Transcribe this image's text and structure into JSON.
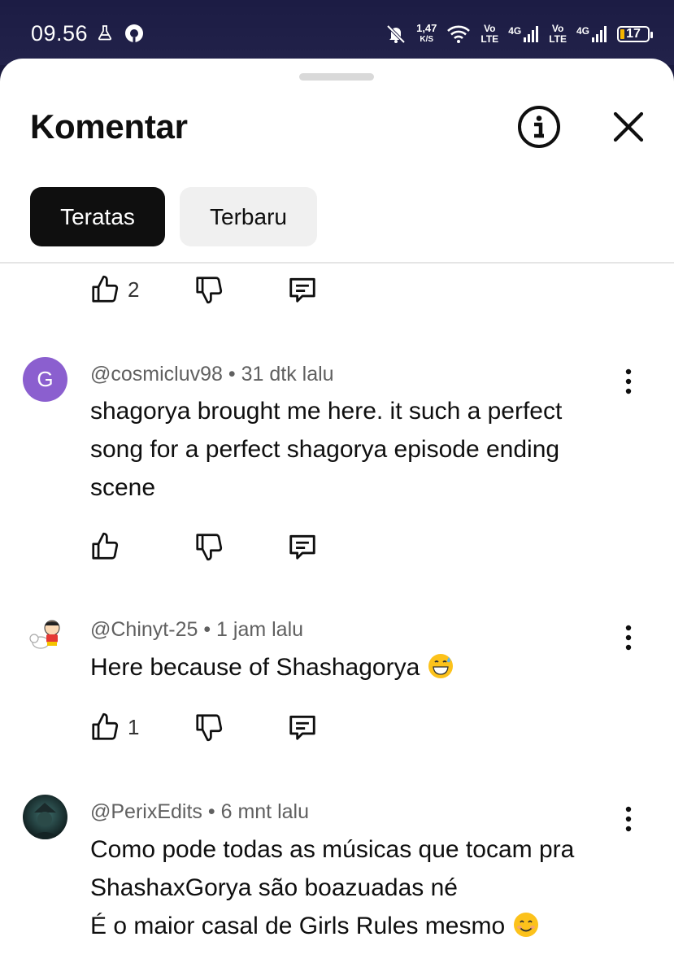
{
  "status": {
    "time": "09.56",
    "net_speed": "1,47",
    "net_unit": "K/S",
    "volte1_top": "Vo",
    "volte1_bottom": "LTE",
    "sim1_type": "4G",
    "volte2_top": "Vo",
    "volte2_bottom": "LTE",
    "sim2_type": "4G",
    "battery": "17",
    "battery_color": "#f5b400"
  },
  "sheet": {
    "title": "Komentar",
    "tabs": [
      {
        "label": "Teratas",
        "selected": true
      },
      {
        "label": "Terbaru",
        "selected": false
      }
    ]
  },
  "prev_comment_actions": {
    "like_count": "2"
  },
  "comments": [
    {
      "author": "@cosmicluv98",
      "time": "31 dtk lalu",
      "avatar_letter": "G",
      "avatar_color": "#8b5fcf",
      "lines": [
        "shagorya brought me here. it such a perfect",
        "song for a perfect shagorya episode ending",
        "scene"
      ],
      "like_count": ""
    },
    {
      "author": "@Chinyt-25",
      "time": "1 jam lalu",
      "lines": [
        "Here because of Shashagorya"
      ],
      "emoji": "sweat-smile-emoji",
      "like_count": "1"
    },
    {
      "author": "@PerixEdits",
      "time": "6 mnt lalu",
      "lines": [
        "Como pode todas as músicas que tocam pra",
        "ShashaxGorya são boazuadas né",
        "É o maior casal de Girls Rules mesmo"
      ],
      "emoji": "smile-emoji"
    }
  ],
  "separator": "•"
}
